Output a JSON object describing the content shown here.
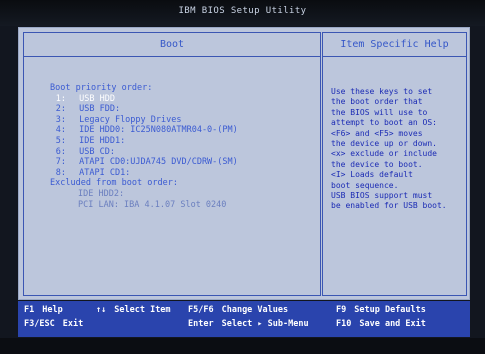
{
  "window": {
    "title": "IBM BIOS Setup Utility"
  },
  "left_panel": {
    "header": "Boot",
    "items": [
      {
        "num": "",
        "text": "Boot priority order:"
      },
      {
        "num": "1:",
        "text": "USB HDD"
      },
      {
        "num": "2:",
        "text": "USB FDD:"
      },
      {
        "num": "3:",
        "text": "Legacy Floppy Drives"
      },
      {
        "num": "4:",
        "text": "IDE HDD0: IC25N080ATMR04-0-(PM)"
      },
      {
        "num": "5:",
        "text": "IDE HDD1:"
      },
      {
        "num": "6:",
        "text": "USB CD:"
      },
      {
        "num": "7:",
        "text": "ATAPI CD0:UJDA745 DVD/CDRW-(SM)"
      },
      {
        "num": "8:",
        "text": "ATAPI CD1:"
      },
      {
        "num": "",
        "text": "Excluded from boot order:"
      },
      {
        "num": "",
        "text": "IDE HDD2:"
      },
      {
        "num": "",
        "text": "PCI LAN:  IBA 4.1.07 Slot 0240"
      }
    ]
  },
  "right_panel": {
    "header": "Item Specific Help",
    "help_lines": [
      "Use these keys to set",
      "the boot order that",
      "the BIOS will use to",
      "attempt to boot an OS:",
      "<F6> and <F5> moves",
      "the device up or down.",
      "<x> exclude or include",
      "the device to boot.",
      "<I> Loads default",
      "boot sequence.",
      "USB BIOS support must",
      "be enabled for USB boot."
    ]
  },
  "footer": {
    "f1_key": "F1",
    "f1_label": "Help",
    "arrows_key": "↑↓",
    "arrows_label": "Select Item",
    "f5f6_key": "F5/F6",
    "f5f6_label": "Change Values",
    "f9_key": "F9",
    "f9_label": "Setup Defaults",
    "esc_key": "F3/ESC",
    "esc_label": "Exit",
    "enter_key": "Enter",
    "enter_label": "Select ▸ Sub-Menu",
    "f10_key": "F10",
    "f10_label": "Save and Exit"
  },
  "colors": {
    "background": "#bcc6dc",
    "accent": "#3b5bd2",
    "selected": "#ffffff",
    "footer": "#2a44ad"
  }
}
